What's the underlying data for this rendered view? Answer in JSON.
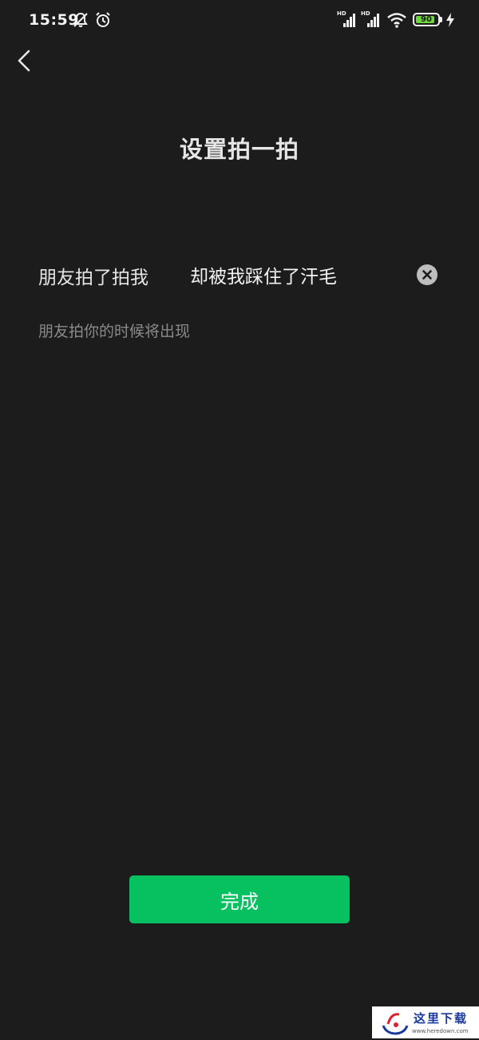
{
  "status_bar": {
    "time": "15:59",
    "icons": [
      "mute-icon",
      "alarm-icon",
      "signal-icon",
      "signal-icon",
      "wifi-icon",
      "battery-icon",
      "charging-icon"
    ],
    "hd_label_1": "HD",
    "hd_label_2": "HD",
    "battery_percent": 90,
    "battery_text": "90"
  },
  "header": {
    "back_icon": "chevron-left-icon",
    "title": "设置拍一拍"
  },
  "pat": {
    "prefix": "朋友拍了拍我",
    "suffix_value": "却被我踩住了汗毛",
    "clear_icon": "clear-circle-icon",
    "hint": "朋友拍你的时候将出现"
  },
  "actions": {
    "done_label": "完成"
  },
  "watermark": {
    "text": "这里下载",
    "url": "www.heredown.com"
  },
  "colors": {
    "background": "#1c1c1d",
    "accent": "#07c160",
    "battery": "#6cd83a"
  }
}
